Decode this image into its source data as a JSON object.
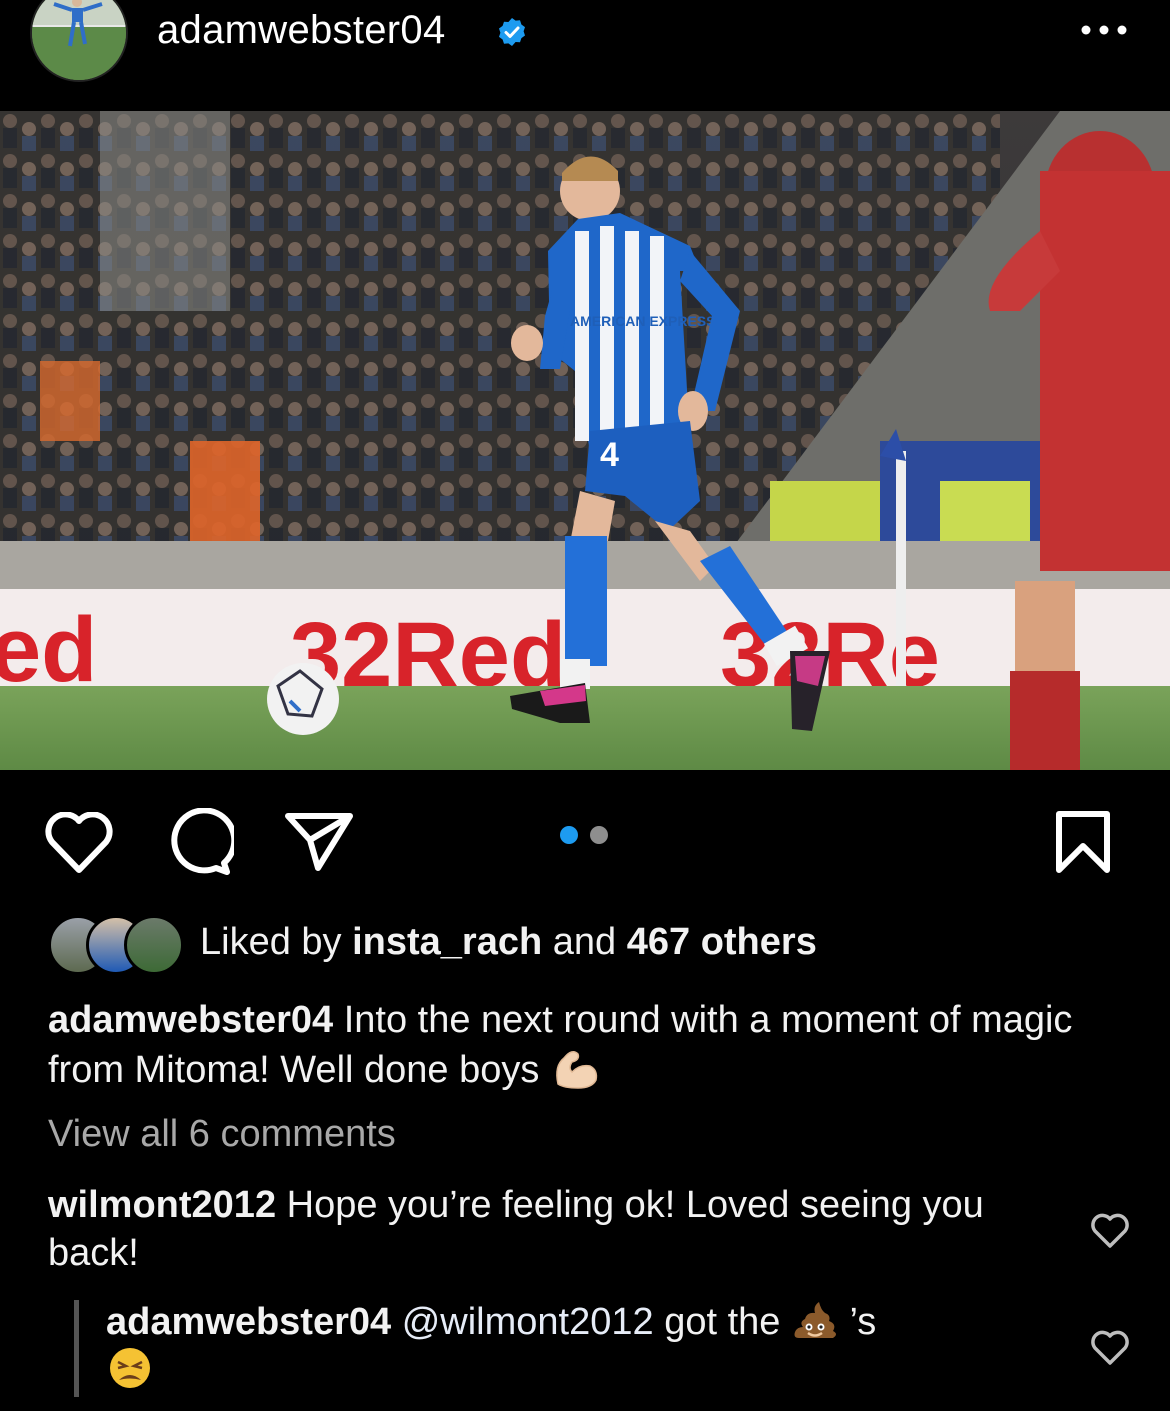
{
  "post": {
    "username": "adamwebster04",
    "liked_by_prefix": "Liked by",
    "liked_by_user": "insta_rach",
    "liked_by_and": "and",
    "liked_by_others": "467 others",
    "caption_user": "adamwebster04",
    "caption_text": "Into the next round with a moment of magic from Mitoma! Well done boys",
    "caption_emoji": "flexed-biceps",
    "view_all_comments": "View all 6 comments",
    "carousel_index": 1,
    "carousel_count": 2
  },
  "photo": {
    "ad_board_text_1": "ed",
    "ad_board_text_2": "32Red",
    "ad_board_text_3": "32Re",
    "shirt_sponsor": "AMERICAN EXPRESS",
    "shirt_number": "4"
  },
  "comments": [
    {
      "user": "wilmont2012",
      "text": "Hope you’re feeling ok! Loved seeing you back!"
    },
    {
      "user": "adamwebster04",
      "mention": "@wilmont2012",
      "text_before_emoji": "got the",
      "emoji_1": "pile-of-poo",
      "text_after_emoji": "’s",
      "emoji_2": "weary-face"
    }
  ],
  "colors": {
    "background": "#000000",
    "verified_blue": "#1d9bf0",
    "carousel_active": "#1d9bf0",
    "carousel_inactive": "#8e8e8e",
    "muted_text": "#a8a8a8"
  },
  "icons": [
    "heart-icon",
    "comment-icon",
    "share-icon",
    "bookmark-icon",
    "more-icon",
    "verified-icon"
  ]
}
